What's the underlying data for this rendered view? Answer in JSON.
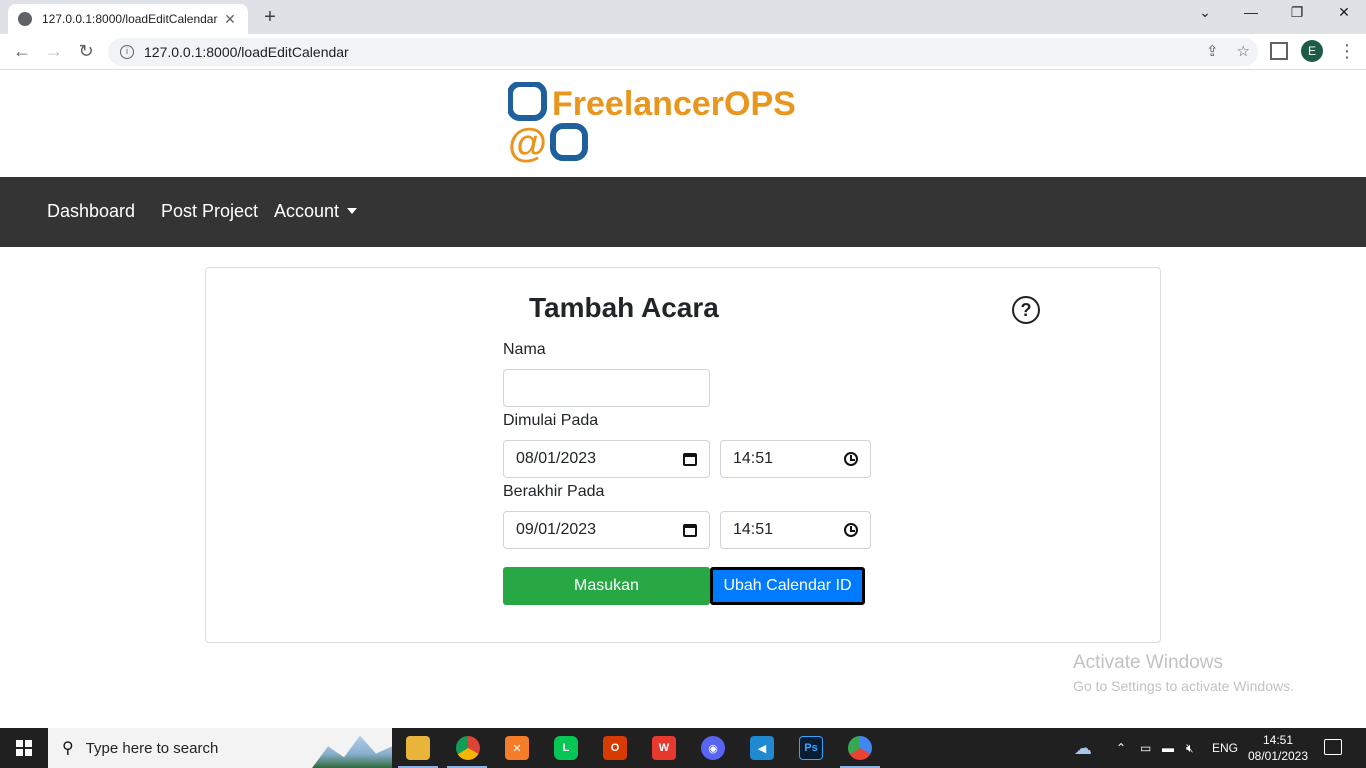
{
  "browser": {
    "tab_title": "127.0.0.1:8000/loadEditCalendar",
    "tab_close": "✕",
    "new_tab": "+",
    "url": "127.0.0.1:8000/loadEditCalendar",
    "profile_initial": "E"
  },
  "logo": {
    "line1": "FreelancerOPS",
    "line2_prefix": "@"
  },
  "navbar": {
    "items": [
      {
        "label": "Dashboard"
      },
      {
        "label": "Post Project"
      },
      {
        "label": "Account"
      }
    ]
  },
  "form": {
    "title": "Tambah Acara",
    "help": "?",
    "nama_label": "Nama",
    "nama_value": "",
    "start_label": "Dimulai Pada",
    "start_date": "08/01/2023",
    "start_time": "14:51",
    "end_label": "Berakhir Pada",
    "end_date": "09/01/2023",
    "end_time": "14:51",
    "submit_label": "Masukan",
    "change_id_label": "Ubah Calendar ID"
  },
  "watermark": {
    "line1": "Activate Windows",
    "line2": "Go to Settings to activate Windows."
  },
  "taskbar": {
    "search_placeholder": "Type here to search",
    "lang": "ENG",
    "time": "14:51",
    "date": "08/01/2023"
  },
  "colors": {
    "navbar_bg": "#343434",
    "logo_blue": "#1f5f9c",
    "logo_orange": "#e8961e",
    "submit_green": "#28a745",
    "primary_blue": "#007bff"
  }
}
